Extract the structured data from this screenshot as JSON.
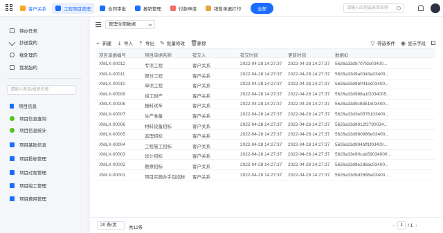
{
  "topbar": {
    "tabs": [
      {
        "label": "客户关系",
        "icon": "star-icon",
        "color": "#f5a623"
      },
      {
        "label": "工程项目管理",
        "icon": "project-icon",
        "color": "#1a6dff"
      },
      {
        "label": "合同审批",
        "icon": "contract-icon",
        "color": "#1a6dff"
      },
      {
        "label": "报销管理",
        "icon": "reimburse-icon",
        "color": "#1a6dff"
      },
      {
        "label": "付款申请",
        "icon": "payment-icon",
        "color": "#f56c6c"
      },
      {
        "label": "销售单据打印",
        "icon": "print-icon",
        "color": "#e6a23c"
      }
    ],
    "all_label": "全部",
    "search_placeholder": "请输入应用或表单名称"
  },
  "sidebar": {
    "top_items": [
      {
        "label": "待办任务",
        "icon": "todo-icon"
      },
      {
        "label": "抄送我的",
        "icon": "send-icon"
      },
      {
        "label": "我处理的",
        "icon": "processed-icon"
      },
      {
        "label": "我发起的",
        "icon": "initiated-icon"
      }
    ],
    "search_placeholder": "请输入表单/报表名称",
    "menu_items": [
      {
        "label": "项目信息",
        "icon": "document-icon",
        "color": "#1a6dff"
      },
      {
        "label": "项目信息查询",
        "icon": "report-icon",
        "color": "#52c41a"
      },
      {
        "label": "项目信息统计",
        "icon": "report-icon",
        "color": "#52c41a"
      },
      {
        "label": "项目基础信息",
        "icon": "folder-icon",
        "color": "#1a6dff"
      },
      {
        "label": "项目投标管理",
        "icon": "folder-icon",
        "color": "#1a6dff"
      },
      {
        "label": "项目过程管理",
        "icon": "folder-icon",
        "color": "#1a6dff"
      },
      {
        "label": "项目竣工管理",
        "icon": "folder-icon",
        "color": "#1a6dff"
      },
      {
        "label": "项目费用管理",
        "icon": "folder-icon",
        "color": "#1a6dff"
      }
    ]
  },
  "main": {
    "view_select": "管理全部数据",
    "toolbar": {
      "new": "新建",
      "import": "导入",
      "export": "导出",
      "batch_edit": "批量修改",
      "delete": "删除",
      "filter": "筛选条件",
      "show_fields": "显示字段"
    },
    "table": {
      "columns": [
        "项目单据编号",
        "项目单据名称",
        "提交人",
        "提交时间",
        "更新时间",
        "数据ID"
      ],
      "rows": [
        [
          "XMLX-00012",
          "专项工程",
          "客户关系",
          "2022-04-28 14:27:37",
          "2022-04-28 14:27:37",
          "5626a33d9707fdc03400..."
        ],
        [
          "XMLX-00011",
          "部分工程",
          "客户关系",
          "2022-04-28 14:27:37",
          "2022-04-28 14:27:37",
          "5626a33d9a0343a03400..."
        ],
        [
          "XMLX-00010",
          "单项工程",
          "客户关系",
          "2022-04-28 14:27:37",
          "2022-04-28 14:27:37",
          "5626a33d9bf4f1ec03400..."
        ],
        [
          "XMLX-00009",
          "竣工财产",
          "客户关系",
          "2022-04-28 14:27:37",
          "2022-04-28 14:27:37",
          "5626a33d988a1f2034005..."
        ],
        [
          "XMLX-00008",
          "报料试车",
          "客户关系",
          "2022-04-28 14:27:37",
          "2022-04-28 14:27:37",
          "5626a33d9c9d51503400..."
        ],
        [
          "XMLX-00007",
          "生产准备",
          "客户关系",
          "2022-04-28 14:27:37",
          "2022-04-28 14:27:37",
          "5626a33d3e0576103400..."
        ],
        [
          "XMLX-00006",
          "材料设备招标",
          "客户关系",
          "2022-04-28 14:27:37",
          "2022-04-28 14:27:37",
          "5626a33d9912f2790034..."
        ],
        [
          "XMLX-00005",
          "监理招标",
          "客户关系",
          "2022-04-28 14:27:37",
          "2022-04-28 14:27:37",
          "5626a33d980986e03400..."
        ],
        [
          "XMLX-00004",
          "工程施工招标",
          "客户关系",
          "2022-04-28 14:27:37",
          "2022-04-28 14:27:37",
          "5626a33d994bff1f03400..."
        ],
        [
          "XMLX-00003",
          "设计招标",
          "客户关系",
          "2022-04-28 14:27:37",
          "2022-04-28 14:27:37",
          "5626a33e90cab59034000..."
        ],
        [
          "XMLX-00002",
          "勘察招标",
          "客户关系",
          "2022-04-28 14:27:37",
          "2022-04-28 14:27:37",
          "5626a33d9e2d8ac03400..."
        ],
        [
          "XMLX-00001",
          "项目实施办手包招标",
          "客户关系",
          "2022-04-28 14:27:37",
          "2022-04-28 14:27:37",
          "5626a33d9d2688a03400..."
        ]
      ]
    },
    "footer": {
      "page_size": "20 条/页",
      "total": "共12条",
      "current_page": "1",
      "total_pages": "/ 1"
    }
  }
}
